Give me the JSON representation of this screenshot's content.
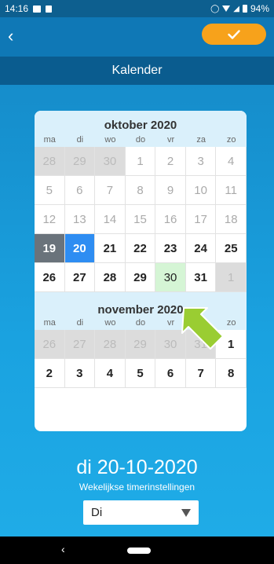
{
  "status": {
    "time": "14:16",
    "battery": "94%"
  },
  "header": {
    "title": "Kalender"
  },
  "weekday_labels": [
    "ma",
    "di",
    "wo",
    "do",
    "vr",
    "za",
    "zo"
  ],
  "months": [
    {
      "title": "oktober 2020",
      "cells": [
        {
          "d": "28",
          "s": "other"
        },
        {
          "d": "29",
          "s": "other"
        },
        {
          "d": "30",
          "s": "other"
        },
        {
          "d": "1",
          "s": "past"
        },
        {
          "d": "2",
          "s": "past"
        },
        {
          "d": "3",
          "s": "past"
        },
        {
          "d": "4",
          "s": "past"
        },
        {
          "d": "5",
          "s": "past"
        },
        {
          "d": "6",
          "s": "past"
        },
        {
          "d": "7",
          "s": "past"
        },
        {
          "d": "8",
          "s": "past"
        },
        {
          "d": "9",
          "s": "past"
        },
        {
          "d": "10",
          "s": "past"
        },
        {
          "d": "11",
          "s": "past"
        },
        {
          "d": "12",
          "s": "past"
        },
        {
          "d": "13",
          "s": "past"
        },
        {
          "d": "14",
          "s": "past"
        },
        {
          "d": "15",
          "s": "past"
        },
        {
          "d": "16",
          "s": "past"
        },
        {
          "d": "17",
          "s": "past"
        },
        {
          "d": "18",
          "s": "past"
        },
        {
          "d": "19",
          "s": "sel-dark"
        },
        {
          "d": "20",
          "s": "sel-blue"
        },
        {
          "d": "21",
          "s": "bold"
        },
        {
          "d": "22",
          "s": "bold"
        },
        {
          "d": "23",
          "s": "bold"
        },
        {
          "d": "24",
          "s": "bold"
        },
        {
          "d": "25",
          "s": "bold"
        },
        {
          "d": "26",
          "s": "bold"
        },
        {
          "d": "27",
          "s": "bold"
        },
        {
          "d": "28",
          "s": "bold"
        },
        {
          "d": "29",
          "s": "bold"
        },
        {
          "d": "30",
          "s": "today"
        },
        {
          "d": "31",
          "s": "bold"
        },
        {
          "d": "1",
          "s": "other"
        }
      ]
    },
    {
      "title": "november 2020",
      "cells": [
        {
          "d": "26",
          "s": "other"
        },
        {
          "d": "27",
          "s": "other"
        },
        {
          "d": "28",
          "s": "other"
        },
        {
          "d": "29",
          "s": "other"
        },
        {
          "d": "30",
          "s": "other"
        },
        {
          "d": "31",
          "s": "other"
        },
        {
          "d": "1",
          "s": "bold"
        },
        {
          "d": "2",
          "s": "bold"
        },
        {
          "d": "3",
          "s": "bold"
        },
        {
          "d": "4",
          "s": "bold"
        },
        {
          "d": "5",
          "s": "bold"
        },
        {
          "d": "6",
          "s": "bold"
        },
        {
          "d": "7",
          "s": "bold"
        },
        {
          "d": "8",
          "s": "bold"
        }
      ]
    }
  ],
  "selected_date": "di 20-10-2020",
  "timer_label": "Wekelijkse timerinstellingen",
  "day_select": {
    "value": "Di"
  },
  "colors": {
    "accent": "#f7a21b",
    "selected_blue": "#2e8df2",
    "selected_dark": "#6a737b",
    "today_green": "#d5f5d5",
    "pointer": "#9acd32"
  }
}
